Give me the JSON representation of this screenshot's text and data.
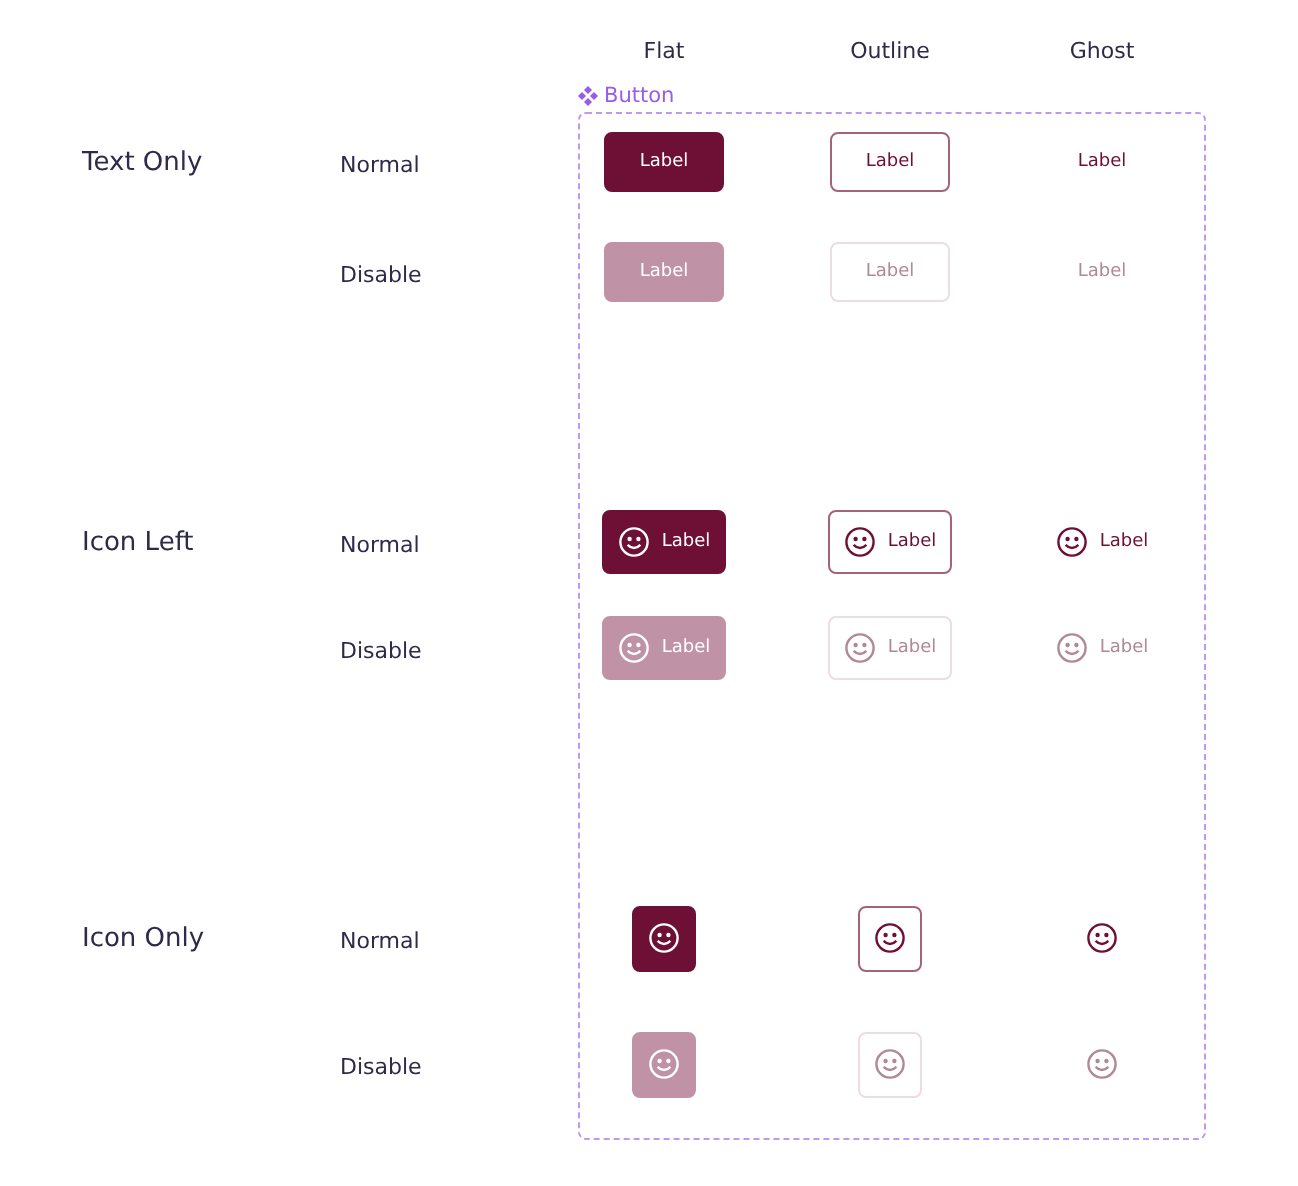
{
  "columns": [
    "Flat",
    "Outline",
    "Ghost"
  ],
  "component": {
    "name": "Button"
  },
  "groups": [
    {
      "label": "Text Only",
      "kind": "text",
      "rows": [
        {
          "state": "Normal",
          "disabled": false,
          "buttons": [
            {
              "kind": "flat",
              "label": "Label"
            },
            {
              "kind": "outline",
              "label": "Label"
            },
            {
              "kind": "ghost",
              "label": "Label"
            }
          ]
        },
        {
          "state": "Disable",
          "disabled": true,
          "buttons": [
            {
              "kind": "flat",
              "label": "Label"
            },
            {
              "kind": "outline",
              "label": "Label"
            },
            {
              "kind": "ghost",
              "label": "Label"
            }
          ]
        }
      ]
    },
    {
      "label": "Icon Left",
      "kind": "icon-left",
      "rows": [
        {
          "state": "Normal",
          "disabled": false,
          "buttons": [
            {
              "kind": "flat",
              "label": "Label"
            },
            {
              "kind": "outline",
              "label": "Label"
            },
            {
              "kind": "ghost",
              "label": "Label"
            }
          ]
        },
        {
          "state": "Disable",
          "disabled": true,
          "buttons": [
            {
              "kind": "flat",
              "label": "Label"
            },
            {
              "kind": "outline",
              "label": "Label"
            },
            {
              "kind": "ghost",
              "label": "Label"
            }
          ]
        }
      ]
    },
    {
      "label": "Icon Only",
      "kind": "icon-only",
      "rows": [
        {
          "state": "Normal",
          "disabled": false,
          "buttons": [
            {
              "kind": "flat"
            },
            {
              "kind": "outline"
            },
            {
              "kind": "ghost"
            }
          ]
        },
        {
          "state": "Disable",
          "disabled": true,
          "buttons": [
            {
              "kind": "flat"
            },
            {
              "kind": "outline"
            },
            {
              "kind": "ghost"
            }
          ]
        }
      ]
    }
  ]
}
